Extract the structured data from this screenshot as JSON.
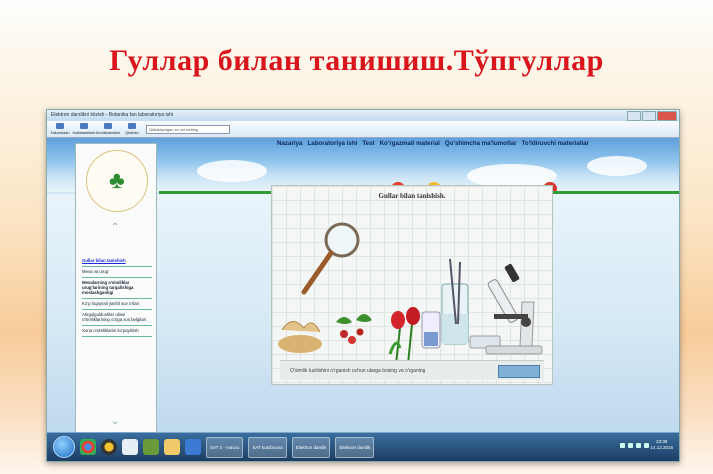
{
  "slide": {
    "title": "Гуллар билан танишиш.Тўпгуллар"
  },
  "window": {
    "title": "Elektron darslikni ktizish - Botanika fan laboratoriya ishi",
    "toolbar": {
      "buttons": [
        "Takomlash",
        "Kattalashtish",
        "Kichiklashtish",
        "Qidirish"
      ],
      "search_placeholder": "Qidirilayotgan so`zni kiriting"
    }
  },
  "nav": {
    "items": [
      "Nazariya",
      "Laboratoriya ishi",
      "Test",
      "Ko'rgazmali material",
      "Qo'shimcha ma'lumotlar",
      "To'ldiruvchi materiallar"
    ]
  },
  "sidebar": {
    "items": [
      {
        "label": "Gullar bilan tanishish",
        "state": "active"
      },
      {
        "label": "Meva va urug'",
        "state": "normal"
      },
      {
        "label": "Mevalarning o'simliklar urug'larining tarqalishiga moslashganligi",
        "state": "bold"
      },
      {
        "label": "Ko'p hujayrali yashil suv o'tlari",
        "state": "normal"
      },
      {
        "label": "Atirgulguldoshlar oilasi o'simliklarining o'ziga xos belgilari",
        "state": "normal"
      },
      {
        "label": "Xona o'simliklarini ko'paytirish",
        "state": "normal"
      }
    ]
  },
  "panel": {
    "title": "Gullar bilan tanishish.",
    "footer_text": "O'simlik tuzilishini o'rganish uchun ularga bosing va o'rganing"
  },
  "taskbar": {
    "tasks": [
      "SAT 2 - mavzu",
      "SAT kutubxona",
      "Elektron darslik",
      "Elektron darslik"
    ],
    "clock_time": "23:38",
    "clock_date": "14.12.2016"
  }
}
